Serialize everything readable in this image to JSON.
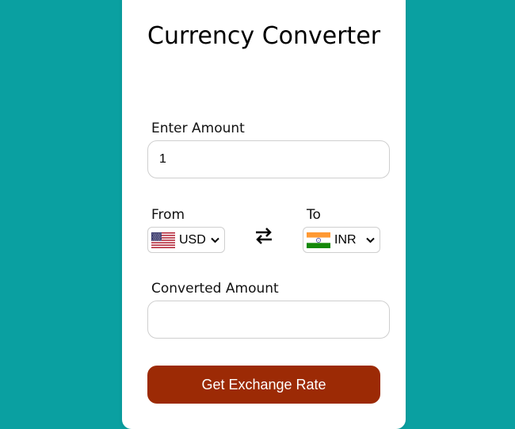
{
  "title": "Currency Converter",
  "amount": {
    "label": "Enter Amount",
    "value": "1"
  },
  "from": {
    "label": "From",
    "currency": "USD",
    "flag": "us-flag-icon"
  },
  "to": {
    "label": "To",
    "currency": "INR",
    "flag": "india-flag-icon"
  },
  "swap_icon": "swap-arrows-icon",
  "converted": {
    "label": "Converted Amount",
    "value": ""
  },
  "button": {
    "label": "Get Exchange Rate"
  },
  "colors": {
    "background": "#0aa0a1",
    "card": "#ffffff",
    "button": "#9c2a05",
    "button_text": "#ffffff"
  }
}
